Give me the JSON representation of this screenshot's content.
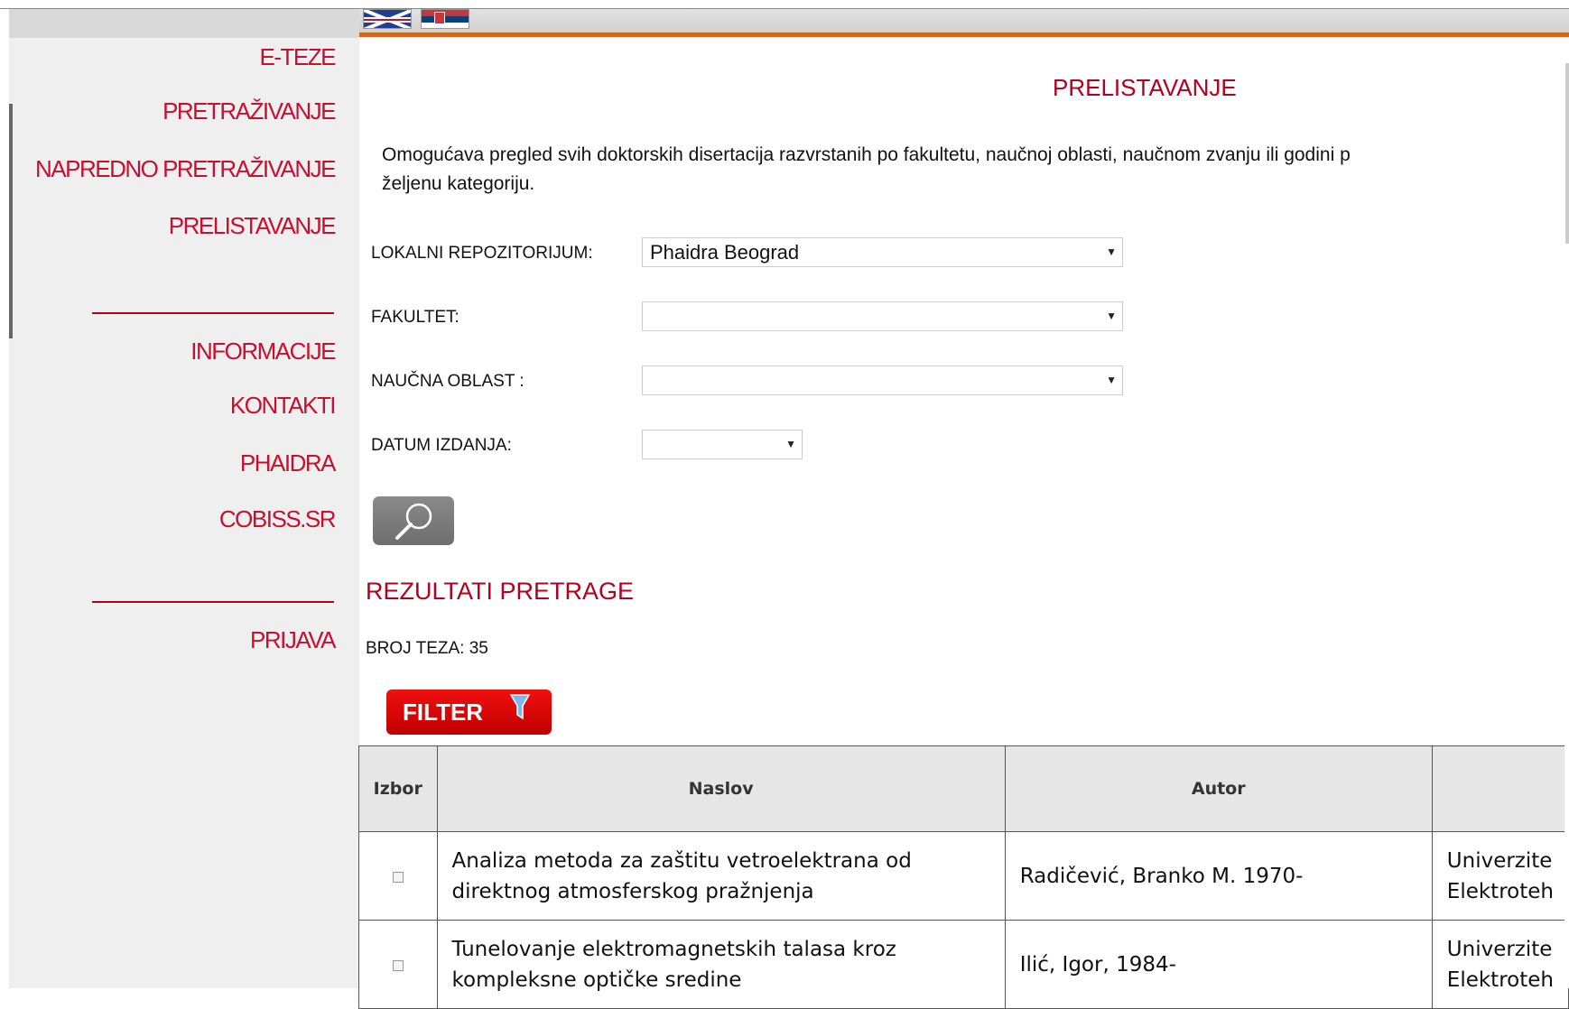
{
  "languages": {
    "en": "English",
    "sr": "Srpski"
  },
  "sidebar": {
    "items": [
      {
        "label": "E-TEZE"
      },
      {
        "label": "PRETRAŽIVANJE"
      },
      {
        "label": "NAPREDNO PRETRAŽIVANJE"
      },
      {
        "label": "PRELISTAVANJE"
      }
    ],
    "info_items": [
      {
        "label": "INFORMACIJE"
      },
      {
        "label": "KONTAKTI"
      },
      {
        "label": "PHAIDRA"
      },
      {
        "label": "COBISS.SR"
      }
    ],
    "login": {
      "label": "PRIJAVA"
    }
  },
  "main": {
    "title": "PRELISTAVANJE",
    "description": "Omogućava pregled svih doktorskih disertacija razvrstanih po fakultetu, naučnoj oblasti, naučnom zvanju ili godini p",
    "description_line2": "željenu kategoriju.",
    "filters": {
      "repo_label": "LOKALNI REPOZITORIJUM:",
      "repo_value": "Phaidra Beograd",
      "faculty_label": "FAKULTET:",
      "faculty_value": "",
      "field_label": "NAUČNA OBLAST :",
      "field_value": "",
      "date_label": "DATUM IZDANJA:",
      "date_value": ""
    },
    "search_icon": "magnifier-icon",
    "results_title": "REZULTATI PRETRAGE",
    "count_label": "BROJ TEZA:",
    "count_value": "35",
    "filter_label": "FILTER",
    "table": {
      "headers": [
        "Izbor",
        "Naslov",
        "Autor",
        ""
      ],
      "rows": [
        {
          "title_line1": "Analiza metoda za zaštitu vetroelektrana od",
          "title_line2": "direktnog atmosferskog pražnjenja",
          "author": "Radičević, Branko M. 1970-",
          "extra_line1": "Univerzite",
          "extra_line2": "Elektroteh"
        },
        {
          "title_line1": "Tunelovanje elektromagnetskih talasa kroz",
          "title_line2": "kompleksne optičke sredine",
          "author": "Ilić, Igor, 1984-",
          "extra_line1": "Univerzite",
          "extra_line2": "Elektroteh"
        }
      ]
    }
  },
  "colors": {
    "accent": "#b2001e",
    "nav": "#c8102e",
    "topline": "#d2631a",
    "filter": "#e00000"
  }
}
